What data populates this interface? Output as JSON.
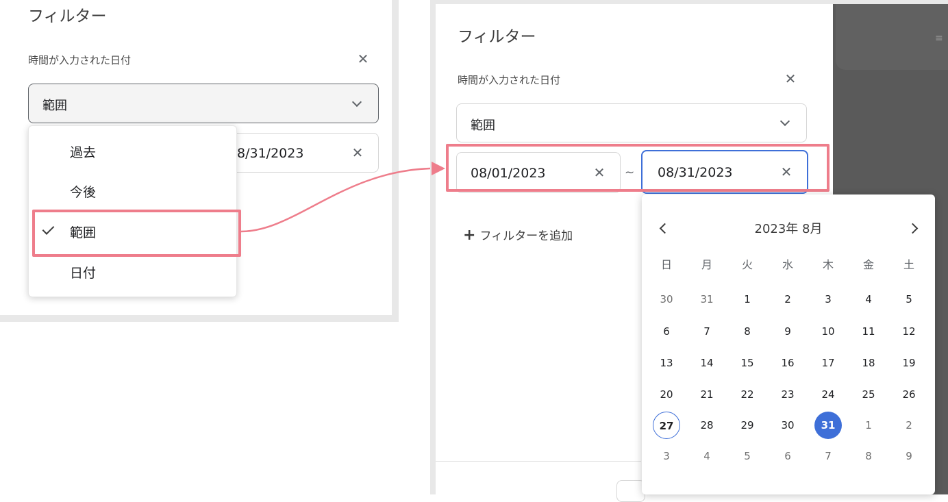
{
  "left": {
    "title": "フィルター",
    "field_label": "時間が入力された日付",
    "select_value": "範囲",
    "date_value_partial": "8/31/2023",
    "options": [
      {
        "label": "過去",
        "selected": false
      },
      {
        "label": "今後",
        "selected": false
      },
      {
        "label": "範囲",
        "selected": true
      },
      {
        "label": "日付",
        "selected": false
      }
    ]
  },
  "right": {
    "title": "フィルター",
    "field_label": "時間が入力された日付",
    "select_value": "範囲",
    "start_date": "08/01/2023",
    "end_date": "08/31/2023",
    "separator": "~",
    "add_filter_label": "フィルターを追加"
  },
  "calendar": {
    "month_title": "2023年 8月",
    "weekdays": [
      "日",
      "月",
      "火",
      "水",
      "木",
      "金",
      "土"
    ],
    "weeks": [
      [
        "30",
        "31",
        "1",
        "2",
        "3",
        "4",
        "5"
      ],
      [
        "6",
        "7",
        "8",
        "9",
        "10",
        "11",
        "12"
      ],
      [
        "13",
        "14",
        "15",
        "16",
        "17",
        "18",
        "19"
      ],
      [
        "20",
        "21",
        "22",
        "23",
        "24",
        "25",
        "26"
      ],
      [
        "27",
        "28",
        "29",
        "30",
        "31",
        "1",
        "2"
      ],
      [
        "3",
        "4",
        "5",
        "6",
        "7",
        "8",
        "9"
      ]
    ],
    "today": "27",
    "selected": "31"
  },
  "colors": {
    "accent": "#3e6fd8",
    "highlight": "#ee7d8b"
  }
}
